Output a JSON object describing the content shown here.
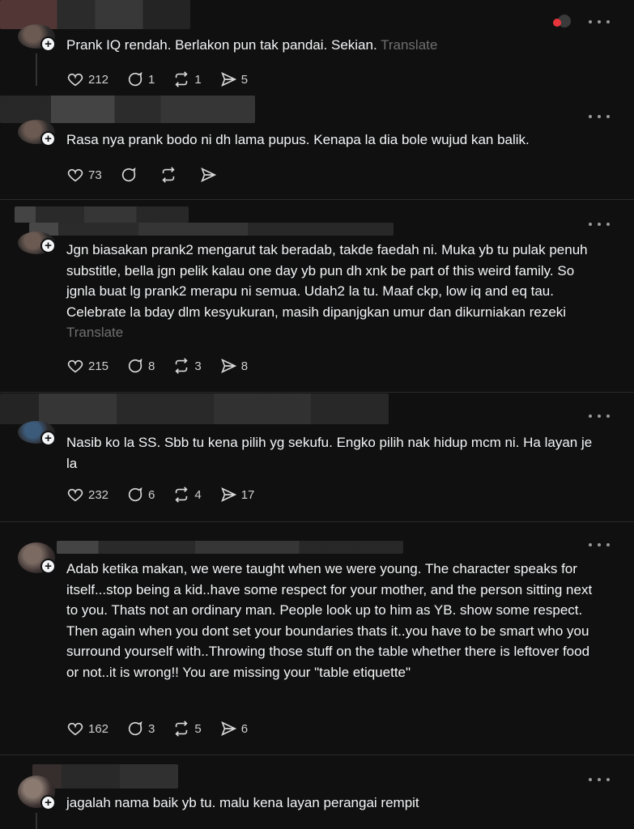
{
  "posts": [
    {
      "text": "Prank IQ rendah. Berlakon pun tak pandai. Sekian.",
      "translate": "Translate",
      "likes": "212",
      "replies": "1",
      "reposts": "1",
      "shares": "5"
    },
    {
      "text": "Rasa nya prank bodo ni dh lama pupus. Kenapa la dia bole wujud kan balik.",
      "translate": "",
      "likes": "73",
      "replies": "",
      "reposts": "",
      "shares": ""
    },
    {
      "text": "Jgn biasakan prank2 mengarut tak beradab, takde faedah ni. Muka yb tu pulak penuh substitle, bella jgn pelik kalau one day yb pun dh xnk be part of this weird family. So jgnla buat lg prank2 merapu ni semua. Udah2 la tu. Maaf ckp, low iq and eq tau. Celebrate la bday dlm kesyukuran, masih dipanjgkan umur dan dikurniakan rezeki",
      "translate": "Translate",
      "likes": "215",
      "replies": "8",
      "reposts": "3",
      "shares": "8"
    },
    {
      "text": "Nasib ko la SS. Sbb tu kena pilih yg sekufu. Engko pilih nak hidup mcm ni. Ha layan je la",
      "translate": "",
      "likes": "232",
      "replies": "6",
      "reposts": "4",
      "shares": "17"
    },
    {
      "text": "Adab ketika makan, we were taught when we were young. The character speaks for itself...stop being a kid..have some respect for your mother, and the person sitting next to you. Thats not an ordinary man. People look up to him as YB. show some respect. Then again when you dont set your boundaries thats it..you have to be smart who you surround yourself with..Throwing those stuff on the table whether there is leftover food or not..it is wrong!! You are missing your \"table etiquette\"",
      "translate": "",
      "likes": "162",
      "replies": "3",
      "reposts": "5",
      "shares": "6"
    },
    {
      "text": "jagalah nama baik yb tu. malu kena layan perangai rempit",
      "translate": "",
      "likes": "",
      "replies": "",
      "reposts": "",
      "shares": ""
    }
  ],
  "icons": {
    "like": "heart-icon",
    "reply": "comment-icon",
    "repost": "repost-icon",
    "share": "send-icon",
    "more": "more-icon"
  }
}
